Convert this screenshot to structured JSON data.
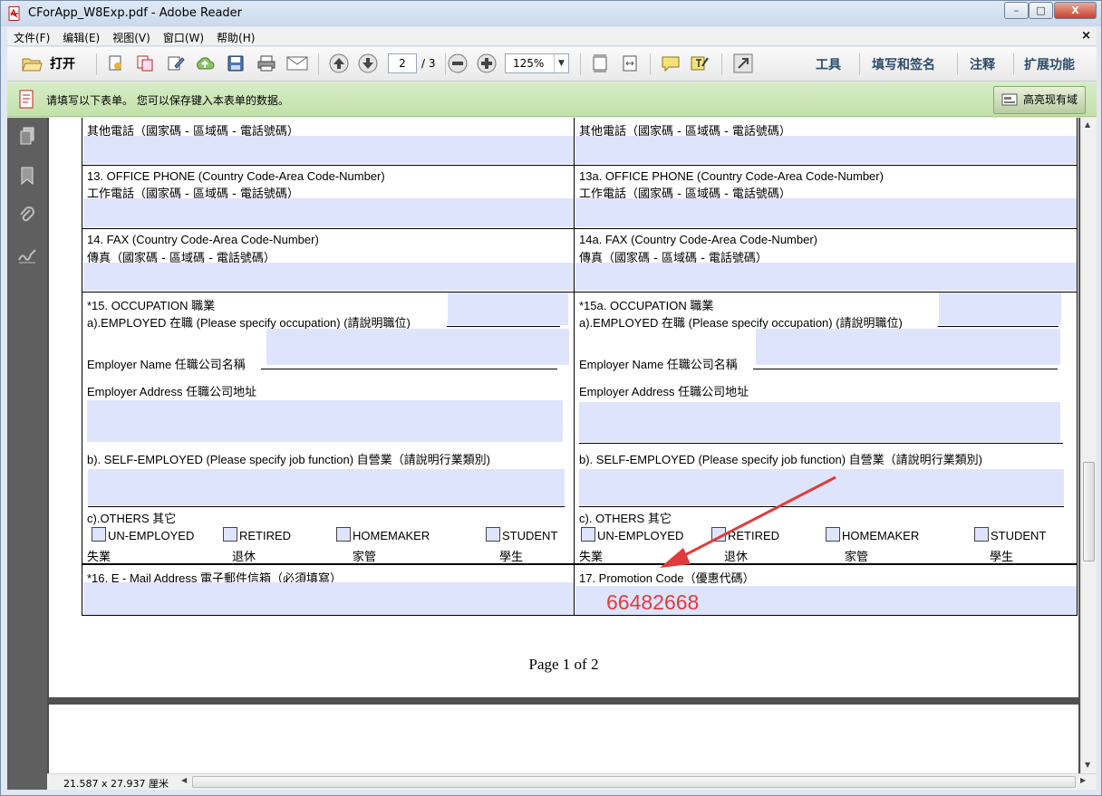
{
  "window": {
    "title": "CForApp_W8Exp.pdf - Adobe Reader",
    "minimize": "–",
    "maximize": "□",
    "close": "X"
  },
  "menu": {
    "items": [
      "文件(F)",
      "编辑(E)",
      "视图(V)",
      "窗口(W)",
      "帮助(H)"
    ],
    "close": "×"
  },
  "toolbar": {
    "open_label": "打开",
    "page_current": "2",
    "page_total": "/ 3",
    "zoom": "125%",
    "tools": "工具",
    "fill_sign": "填写和签名",
    "comment": "注释",
    "extend": "扩展功能"
  },
  "notice": {
    "text": "请填写以下表单。 您可以保存键入本表单的数据。",
    "highlight_button": "高亮现有域"
  },
  "form": {
    "r12_left_zh": "其他電話（國家碼 - 區域碼 - 電話號碼）",
    "r12_right_zh": "其他電話（國家碼 - 區域碼 - 電話號碼）",
    "r13_left_en": "13. OFFICE PHONE (Country Code-Area Code-Number)",
    "r13_left_zh": "工作電話（國家碼 - 區域碼 - 電話號碼）",
    "r13_right_en": "13a. OFFICE PHONE (Country Code-Area Code-Number)",
    "r13_right_zh": "工作電話（國家碼 - 區域碼 - 電話號碼）",
    "r14_left_en": "14. FAX (Country Code-Area Code-Number)",
    "r14_left_zh": "傳真（國家碼 - 區域碼 - 電話號碼）",
    "r14_right_en": "14a. FAX  (Country Code-Area Code-Number)",
    "r14_right_zh": "傳真（國家碼 - 區域碼 - 電話號碼）",
    "occ_left_title": "*15.  OCCUPATION 職業",
    "occ_right_title": "*15a. OCCUPATION 職業",
    "employed_left": "a).EMPLOYED 在職 (Please specify occupation) (請說明職位)",
    "employed_right": "a).EMPLOYED 在職 (Please specify occupation) (請說明職位)",
    "employer_name": "Employer Name 任職公司名稱",
    "employer_address": "Employer Address 任職公司地址",
    "self_left": "b). SELF-EMPLOYED (Please specify job function) 自營業（請說明行業類別)",
    "self_right": "b). SELF-EMPLOYED (Please specify job function) 自營業（請說明行業類別)",
    "others_left": "c).OTHERS 其它",
    "others_right": "c). OTHERS 其它",
    "opts": [
      {
        "en": "UN-EMPLOYED",
        "zh": "失業"
      },
      {
        "en": "RETIRED",
        "zh": "退休"
      },
      {
        "en": "HOMEMAKER",
        "zh": "家管"
      },
      {
        "en": "STUDENT",
        "zh": "學生"
      }
    ],
    "email_label": "*16. E - Mail Address 電子郵件信箱（必須填寫）",
    "promo_label": "17. Promotion Code（優惠代碼）",
    "promo_value": "66482668"
  },
  "page_footer": "Page 1 of 2",
  "status": {
    "dimensions": "21.587 x 27.937 厘米"
  },
  "colors": {
    "field_fill": "#dfe4fd",
    "annotation_red": "#e23b3b",
    "notice_green": "#c3e0aa"
  }
}
